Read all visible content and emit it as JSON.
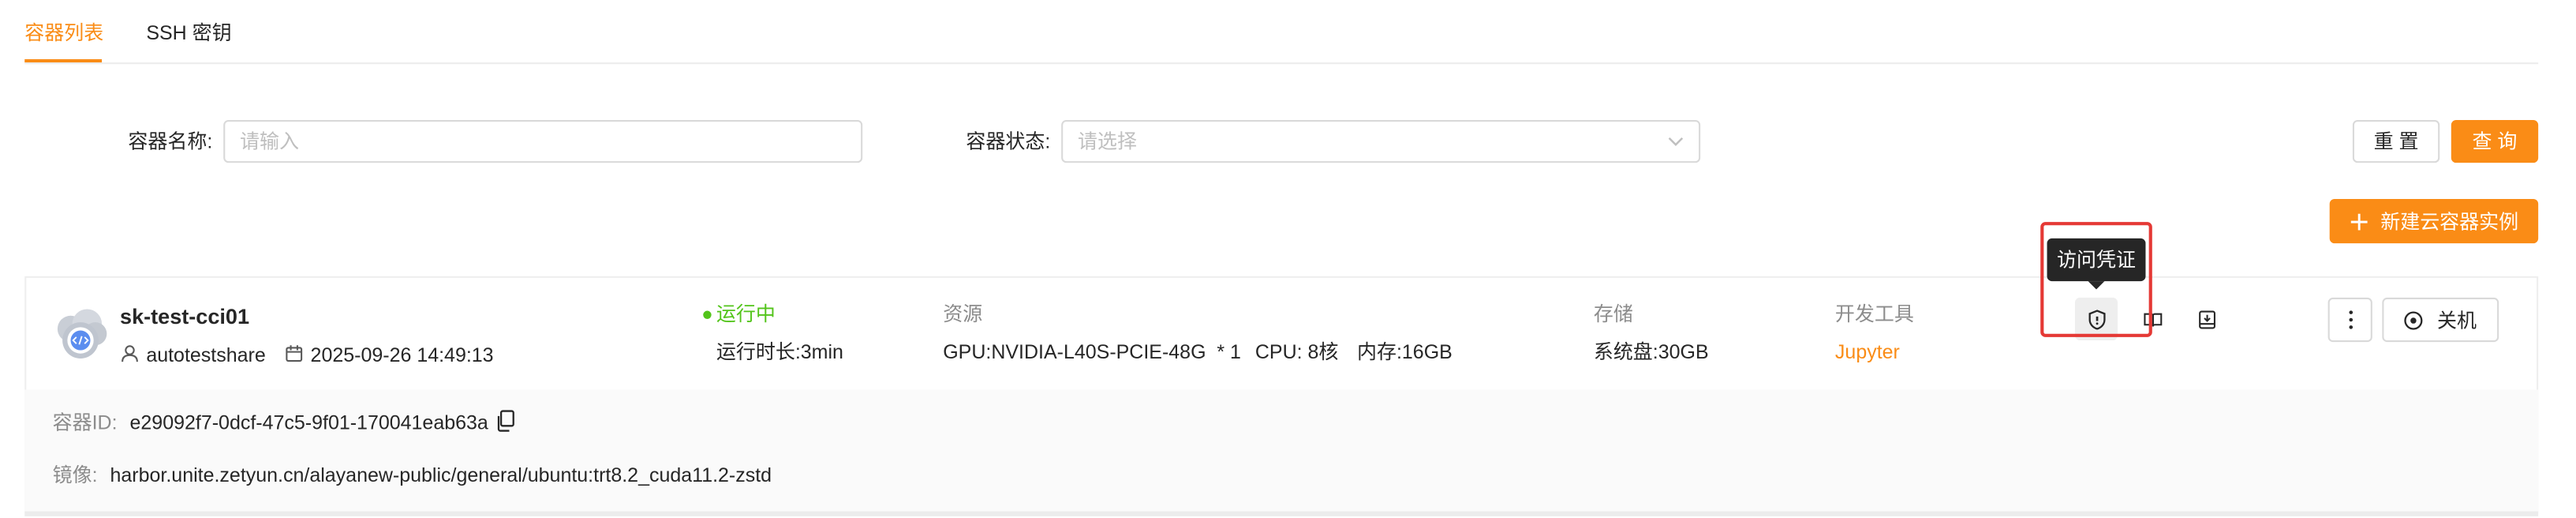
{
  "tabs": [
    {
      "label": "容器列表",
      "active": true
    },
    {
      "label": "SSH 密钥",
      "active": false
    }
  ],
  "filters": {
    "name_label": "容器名称:",
    "name_placeholder": "请输入",
    "status_label": "容器状态:",
    "status_placeholder": "请选择",
    "reset_label": "重 置",
    "search_label": "查 询"
  },
  "create_button": {
    "icon": "plus-icon",
    "label": "新建云容器实例"
  },
  "colors": {
    "accent": "#fa8c16",
    "running": "#52c41a",
    "highlight": "#e53935"
  },
  "container": {
    "name": "sk-test-cci01",
    "owner": "autotestshare",
    "created_at": "2025-09-26 14:49:13",
    "status": "运行中",
    "runtime": "运行时长:3min",
    "resource_title": "资源",
    "gpu": "GPU:NVIDIA-L40S-PCIE-48G  * 1",
    "cpu": "CPU: 8核",
    "memory": "内存:16GB",
    "storage_title": "存储",
    "system_disk": "系统盘:30GB",
    "tools_title": "开发工具",
    "tool": "Jupyter",
    "id_label": "容器ID:",
    "id_value": "e29092f7-0dcf-47c5-9f01-170041eab63a",
    "image_label": "镜像:",
    "image_value": "harbor.unite.zetyun.cn/alayanew-public/general/ubuntu:trt8.2_cuda11.2-zstd",
    "action_icons": [
      "shield-icon",
      "book-icon",
      "save-icon"
    ],
    "more_icon": "more-vertical-icon",
    "shutdown_label": "关机"
  },
  "tooltip": "访问凭证"
}
